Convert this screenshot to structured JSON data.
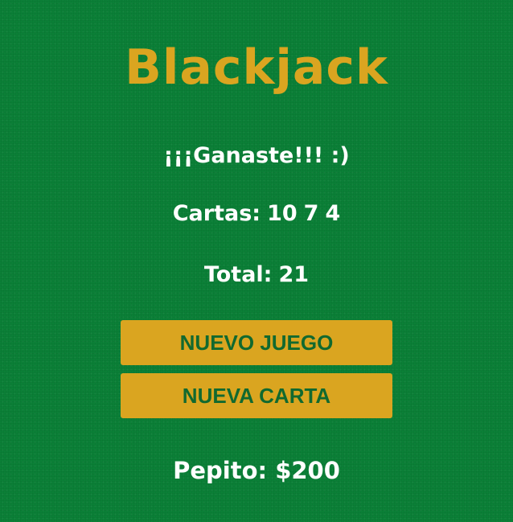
{
  "game": {
    "title": "Blackjack",
    "message": "¡¡¡Ganaste!!! :)"
  },
  "hand": {
    "cards_label": "Cartas:",
    "cards": [
      "10",
      "7",
      "4"
    ],
    "total_label": "Total:",
    "total": "21"
  },
  "buttons": {
    "new_game": "NUEVO JUEGO",
    "new_card": "NUEVA CARTA"
  },
  "player": {
    "name_label": "Pepito:",
    "balance": "$200"
  },
  "colors": {
    "table": "#0b8037",
    "accent": "#daa520",
    "button_text": "#11692f",
    "text": "#ffffff"
  }
}
